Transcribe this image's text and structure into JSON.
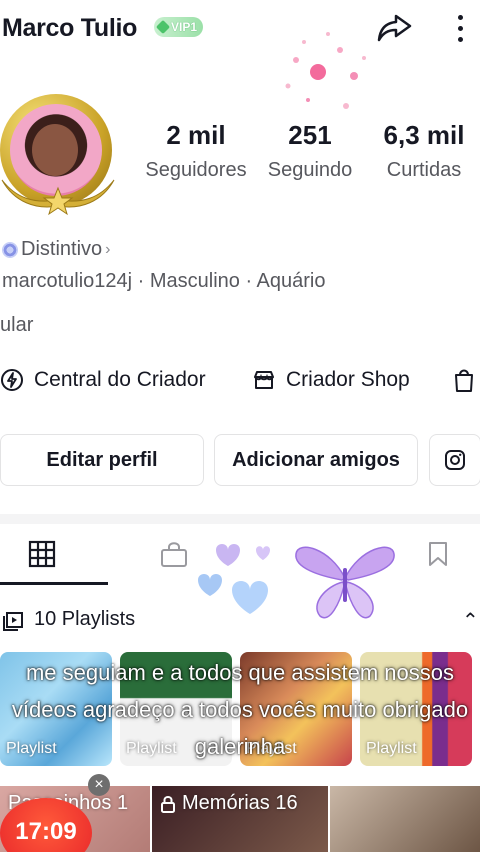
{
  "profile": {
    "display_name": "Marco Tulio",
    "vip_label": "VIP1",
    "stats": {
      "followers_value": "2 mil",
      "followers_label": "Seguidores",
      "following_value": "251",
      "following_label": "Seguindo",
      "likes_value": "6,3 mil",
      "likes_label": "Curtidas"
    },
    "badge_label": "Distintivo",
    "info_line": "marcotulio124j · Masculino · Aquário",
    "bio": "ular"
  },
  "creator_tools": {
    "central_label": "Central do Criador",
    "shop_label": "Criador Shop"
  },
  "actions": {
    "edit_label": "Editar perfil",
    "add_friends_label": "Adicionar amigos"
  },
  "playlists": {
    "header": "10 Playlists",
    "thumbnails": [
      {
        "label": "Playlist"
      },
      {
        "label": "Playlist"
      },
      {
        "label": "Playlist"
      },
      {
        "label": "Playlist"
      }
    ],
    "overlay_caption": "me seguiam e a todos que assistem nossos vídeos agradeço a todos vocês muito obrigado galerinha"
  },
  "bottom_cards": [
    {
      "label": "Passeinhos 1"
    },
    {
      "label": "Memórias 16"
    },
    {
      "label": ""
    }
  ],
  "timer": "17:09",
  "icons": {
    "share": "share-arrow-icon",
    "more": "more-vertical-icon",
    "central": "lightning-icon",
    "shop": "store-icon",
    "bag": "shopping-bag-icon",
    "instagram": "instagram-icon",
    "videos_tab": "grid-icon",
    "private_tab": "lock-bag-icon",
    "saved_tab": "bookmark-icon",
    "playlist": "playlist-icon"
  },
  "colors": {
    "vip": "#4cc36a",
    "text_primary": "#161823",
    "text_secondary": "#57585e",
    "timer": "#e8262a"
  }
}
